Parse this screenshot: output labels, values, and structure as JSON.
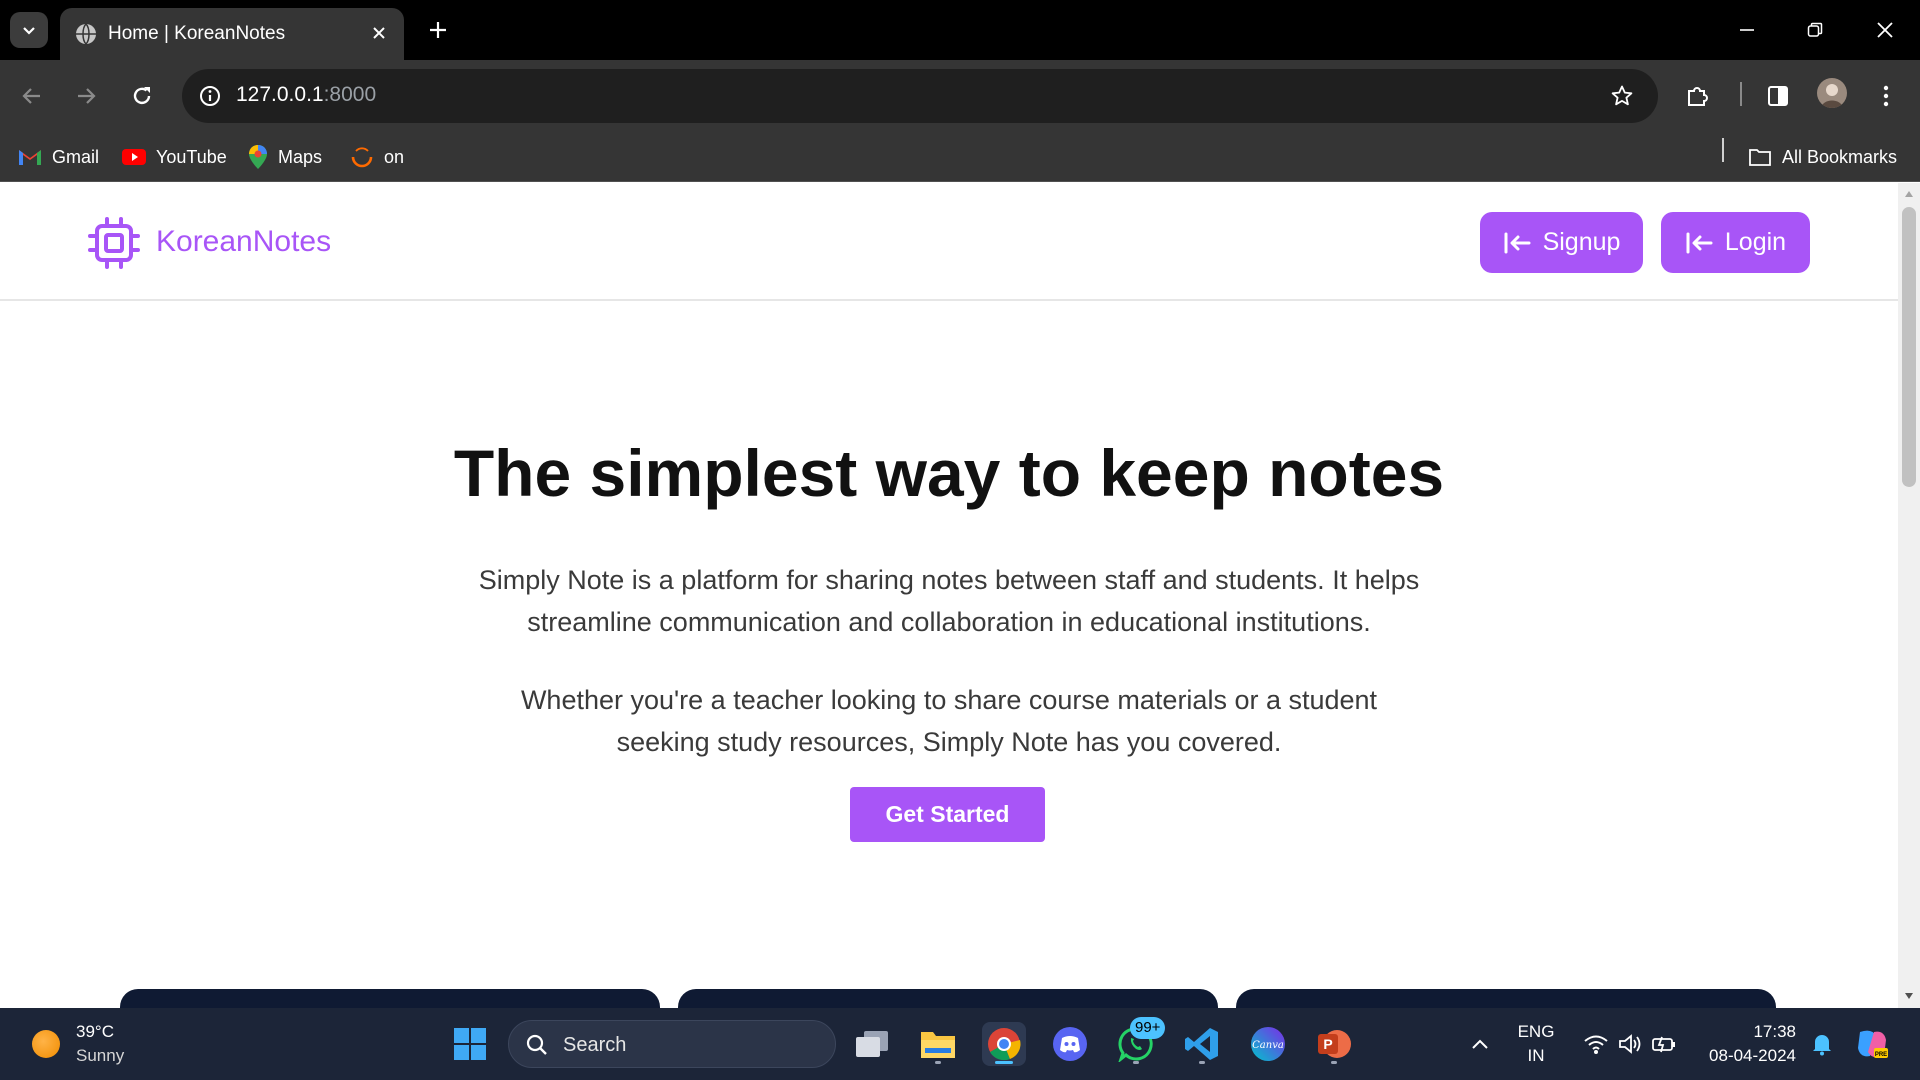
{
  "browser": {
    "tab_title": "Home | KoreanNotes",
    "url_host": "127.0.0.1",
    "url_port": ":8000",
    "bookmarks": [
      {
        "label": "Gmail",
        "icon": "gmail-icon"
      },
      {
        "label": "YouTube",
        "icon": "youtube-icon"
      },
      {
        "label": "Maps",
        "icon": "maps-icon"
      },
      {
        "label": "on",
        "icon": "bookmark-favicon-icon"
      }
    ],
    "all_bookmarks": "All Bookmarks"
  },
  "site": {
    "brand": "KoreanNotes",
    "accent_color": "#a855f7",
    "nav": {
      "signup": "Signup",
      "login": "Login"
    },
    "hero": {
      "title": "The simplest way to keep notes",
      "para1_line1": "Simply Note is a platform for sharing notes between staff and students. It helps",
      "para1_line2": "streamline communication and collaboration in educational institutions.",
      "para2_line1": "Whether you're a teacher looking to share course materials or a student",
      "para2_line2": "seeking study resources, Simply Note has you covered.",
      "cta": "Get Started"
    }
  },
  "taskbar": {
    "weather_temp": "39°C",
    "weather_desc": "Sunny",
    "search_label": "Search",
    "whatsapp_badge": "99+",
    "language": "ENG",
    "region": "IN",
    "time": "17:38",
    "date": "08-04-2024"
  }
}
